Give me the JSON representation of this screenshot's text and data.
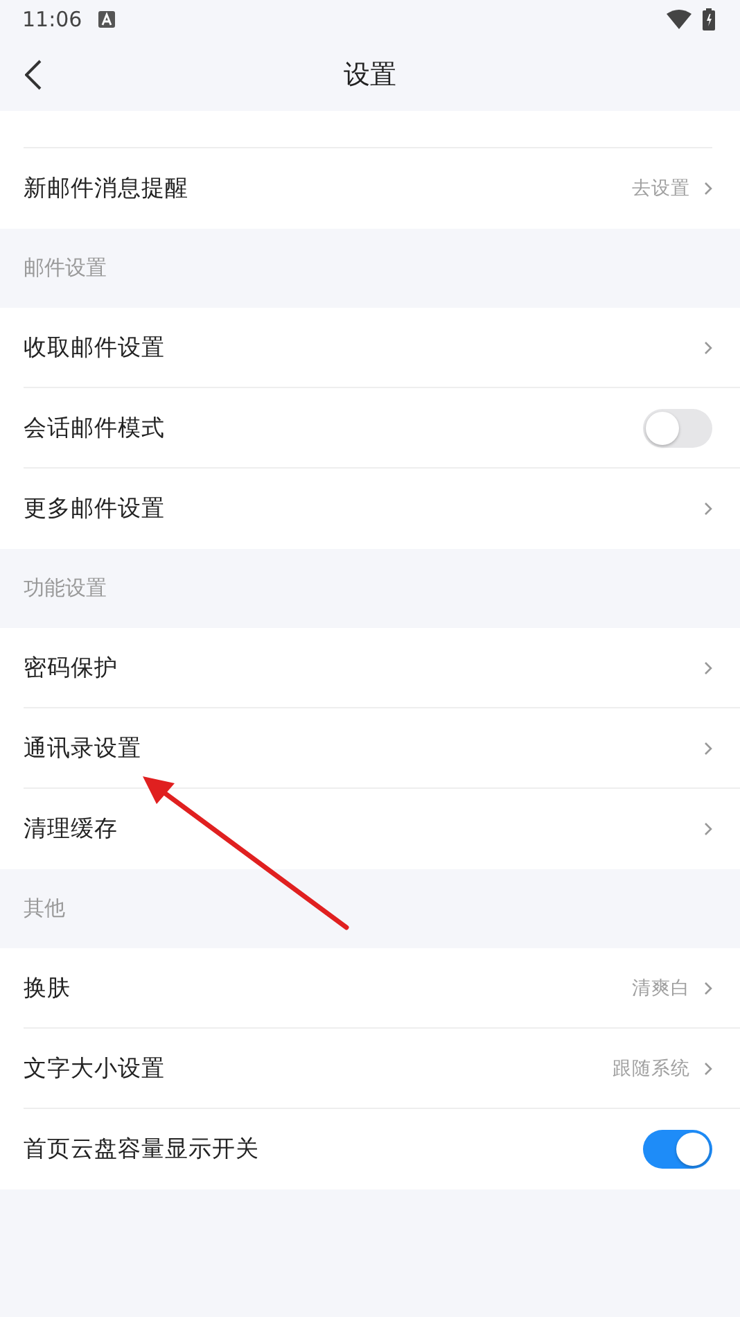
{
  "status_bar": {
    "time": "11:06"
  },
  "header": {
    "title": "设置"
  },
  "sections": [
    {
      "items": [
        {
          "kind": "link",
          "label": "新邮件消息提醒",
          "value": "去设置"
        }
      ]
    },
    {
      "title": "邮件设置",
      "items": [
        {
          "kind": "link",
          "label": "收取邮件设置"
        },
        {
          "kind": "toggle",
          "label": "会话邮件模式",
          "on": false
        },
        {
          "kind": "link",
          "label": "更多邮件设置"
        }
      ]
    },
    {
      "title": "功能设置",
      "items": [
        {
          "kind": "link",
          "label": "密码保护"
        },
        {
          "kind": "link",
          "label": "通讯录设置"
        },
        {
          "kind": "link",
          "label": "清理缓存"
        }
      ]
    },
    {
      "title": "其他",
      "items": [
        {
          "kind": "link",
          "label": "换肤",
          "value": "清爽白"
        },
        {
          "kind": "link",
          "label": "文字大小设置",
          "value": "跟随系统"
        },
        {
          "kind": "toggle",
          "label": "首页云盘容量显示开关",
          "on": true
        }
      ]
    }
  ]
}
